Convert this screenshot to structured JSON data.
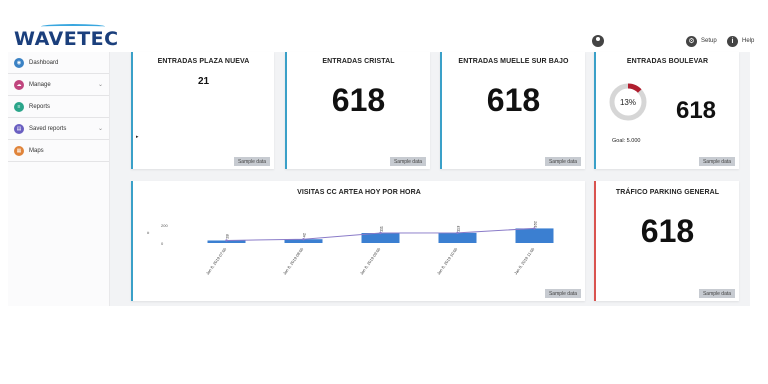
{
  "brand": {
    "logo_text": "WAVETEC",
    "accent": "#1b3f7c",
    "swoosh": "#3aa7df"
  },
  "header": {
    "user_icon": "user-icon",
    "setup_label": "Setup",
    "help_label": "Help"
  },
  "sidebar": {
    "items": [
      {
        "label": "Dashboard",
        "icon": "dashboard-icon",
        "color": "#3b82c4",
        "has_chevron": false
      },
      {
        "label": "Manage",
        "icon": "cloud-icon",
        "color": "#c0457e",
        "has_chevron": true
      },
      {
        "label": "Reports",
        "icon": "reports-icon",
        "color": "#2aa58a",
        "has_chevron": false
      },
      {
        "label": "Saved reports",
        "icon": "saved-reports-icon",
        "color": "#6a5fc1",
        "has_chevron": true
      },
      {
        "label": "Maps",
        "icon": "maps-icon",
        "color": "#e0843a",
        "has_chevron": false
      }
    ]
  },
  "cards": {
    "plaza_nueva": {
      "title": "ENTRADAS PLAZA NUEVA",
      "value": "21",
      "button": "Sample data",
      "border": "#3aa0c8"
    },
    "cristal": {
      "title": "ENTRADAS CRISTAL",
      "value": "618",
      "button": "Sample data",
      "border": "#3aa0c8"
    },
    "muelle": {
      "title": "ENTRADAS MUELLE SUR BAJO",
      "value": "618",
      "button": "Sample data",
      "border": "#3aa0c8"
    },
    "boulevar": {
      "title": "ENTRADAS BOULEVAR",
      "value": "618",
      "percent_label": "13%",
      "goal_label": "Goal: 5.000",
      "percent": 0.13,
      "button": "Sample data",
      "border": "#3aa0c8",
      "donut_color": "#b01e2f",
      "donut_track": "#d6d6d6"
    },
    "parking": {
      "title": "TRÁFICO PARKING GENERAL",
      "value": "618",
      "button": "Sample data",
      "border": "#d9534f"
    },
    "visitas": {
      "title": "VISITAS CC ARTEA HOY POR HORA",
      "button": "Sample data",
      "border": "#3aa0c8"
    }
  },
  "chart_data": {
    "type": "bar",
    "title": "VISITAS CC ARTEA HOY POR HORA",
    "categories": [
      "Jan 8, 2019 07:00",
      "Jan 8, 2019 08:00",
      "Jan 8, 2019 09:00",
      "Jan 8, 2019 10:00",
      "Jan 8, 2019 11:00"
    ],
    "values": [
      28,
      42,
      111,
      113,
      162
    ],
    "bar_labels": [
      "28",
      "42",
      "111",
      "113",
      "162"
    ],
    "ytick_labels": [
      "200",
      "0"
    ],
    "ylim": [
      0,
      200
    ],
    "bar_color": "#3b7fd1",
    "line_color": "#8a7bc8",
    "grid": false,
    "legend": "none"
  }
}
